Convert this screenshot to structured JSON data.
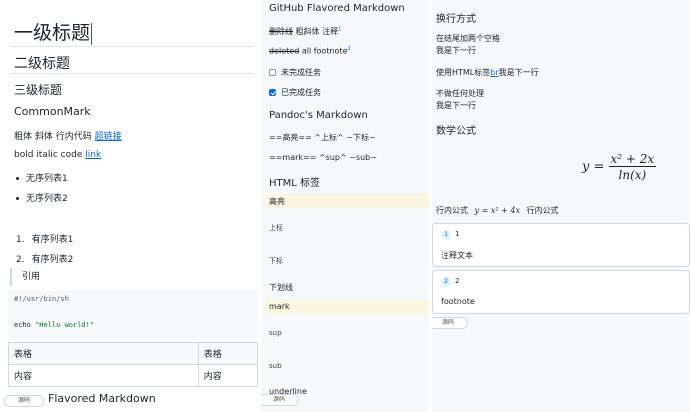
{
  "pane1": {
    "h1": "一级标题",
    "h2": "二级标题",
    "h3": "三级标题",
    "h4": "CommonMark",
    "inline_prefix": "粗体 斜体 行内代码",
    "inline_link": "超链接",
    "inline2_prefix": "bold italic code",
    "inline2_link": "link",
    "ul": [
      "无序列表1",
      "无序列表2"
    ],
    "ol": [
      "有序列表1",
      "有序列表2"
    ],
    "ol_nums": [
      "1.",
      "2."
    ],
    "quote": "引用",
    "code_line1": "#!/usr/bin/sh",
    "code_cmd": "echo",
    "code_str": "\"Hello world!\"",
    "table_headers": [
      "表格",
      "表格"
    ],
    "table_cells": [
      "内容",
      "内容"
    ],
    "bottom_title": "Flavored Markdown",
    "source_button": "源码"
  },
  "pane2": {
    "title": "GitHub Flavored Markdown",
    "strike_line_strike": "删除线",
    "strike_line_rest": "粗斜体 注释",
    "fn1": "1",
    "deleted_word": "deleted",
    "all_footnote": "all footnote",
    "fn2": "2",
    "task_unchecked": "未完成任务",
    "task_checked": "已完成任务",
    "pandoc_title": "Pandoc's Markdown",
    "pandoc_line1": "==高亮== ^上标^ ~下标~",
    "pandoc_line2": "==mark== ^sup^ ~sub~",
    "html_title": "HTML 标签",
    "highlight": "高亮",
    "superscript": "上标",
    "subscript": "下标",
    "underline_cn": "下划线",
    "mark": "mark",
    "sup": "sup",
    "sub": "sub",
    "underline": "underline",
    "source_button": "源码"
  },
  "pane3": {
    "linebreak_title": "换行方式",
    "lb1a": "在结尾加两个空格",
    "lb1b": "我是下一行",
    "lb2_prefix": "使用HTML标签",
    "lb2_tag": "br",
    "lb2_suffix": "我是下一行",
    "lb3a": "不做任何处理",
    "lb3b": "我是下一行",
    "math_title": "数学公式",
    "math_lhs": "y =",
    "math_num": "x² + 2x",
    "math_den": "ln(x)",
    "inline_math_prefix": "行内公式",
    "inline_math": "y = x² + 4x",
    "inline_math_suffix": "行内公式",
    "fn_cards": [
      {
        "num": "1",
        "label": "1",
        "text": "注释文本"
      },
      {
        "num": "2",
        "label": "2",
        "text": "footnote"
      }
    ],
    "source_button": "源码"
  }
}
